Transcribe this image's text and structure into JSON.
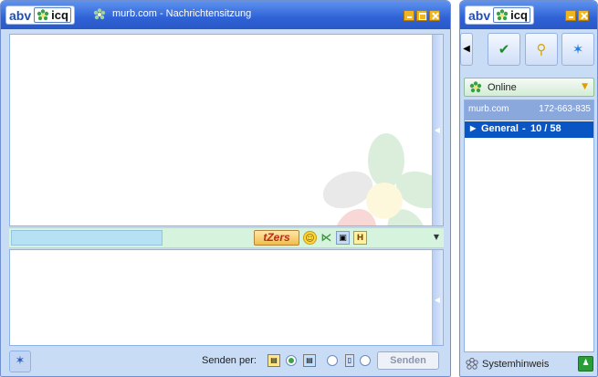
{
  "chat_window": {
    "logo_brand": "abv",
    "logo_product": "icq",
    "title": "murb.com - Nachrichtensitzung",
    "toolbar": {
      "tzers_label": "tZers"
    },
    "bottom": {
      "send_via_label": "Senden per:",
      "send_button": "Senden"
    }
  },
  "contact_window": {
    "logo_brand": "abv",
    "logo_product": "icq",
    "status": "Online",
    "owner": {
      "name": "murb.com",
      "uin": "172-663-835"
    },
    "groups": [
      {
        "name": "General",
        "separator": "-",
        "count": "10 / 58"
      }
    ],
    "system_notice": "Systemhinweis"
  },
  "colors": {
    "titlebar": "#2f62d6",
    "window_bg": "#c9dcf5",
    "toolbar_green": "#d6f3dd",
    "group_selected": "#0a55c4"
  }
}
